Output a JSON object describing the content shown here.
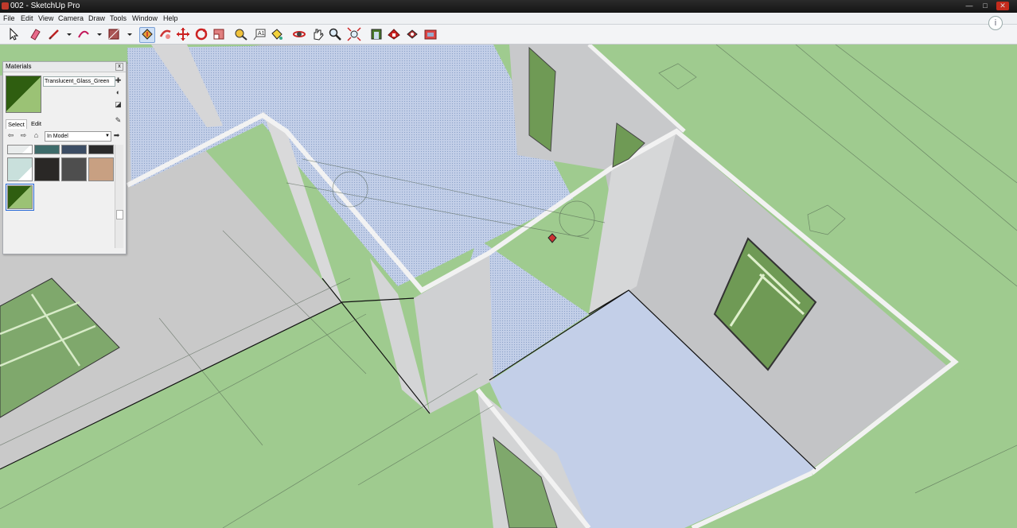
{
  "window": {
    "title": "002 - SketchUp Pro",
    "minimize": "—",
    "maximize": "□",
    "close": "✕"
  },
  "menu": {
    "file": "File",
    "edit": "Edit",
    "view": "View",
    "camera": "Camera",
    "draw": "Draw",
    "tools": "Tools",
    "window": "Window",
    "help": "Help"
  },
  "toolbar": {
    "tools": [
      "select-icon",
      "eraser-icon",
      "pencil-line-icon",
      "arc-icon",
      "rectangle-icon",
      "push-pull-icon",
      "follow-me-icon",
      "move-icon",
      "rotate-icon",
      "scale-icon",
      "tape-measure-icon",
      "text-icon",
      "paint-bucket-icon",
      "orbit-icon",
      "pan-icon",
      "zoom-icon",
      "zoom-extents-icon",
      "warehouse-icon",
      "extension-warehouse-icon",
      "layout-icon",
      "ruby-icon"
    ]
  },
  "info_icon": "i",
  "materials_panel": {
    "title": "Materials",
    "close_glyph": "x",
    "material_name": "Translucent_Glass_Green",
    "tabs": {
      "select": "Select",
      "edit": "Edit"
    },
    "collection": "In Model",
    "back_glyph": "⇦",
    "forward_glyph": "⇨",
    "home_glyph": "⌂",
    "details_glyph": "➡",
    "swatch_colors": [
      "#e9ecec",
      "#3d6b6a",
      "#3b4c63",
      "#2a2a2a",
      "#c9e0dc",
      "#2a2826",
      "#4e4e4e",
      "#c8a082",
      "#3f6a1f"
    ]
  },
  "colors": {
    "ground": "#9fcb8f",
    "wall": "#c6c8ca",
    "floor_blue": "#c3cfe8",
    "glass_green": "#6f9a55",
    "wall_edge": "#f2f2f2"
  }
}
